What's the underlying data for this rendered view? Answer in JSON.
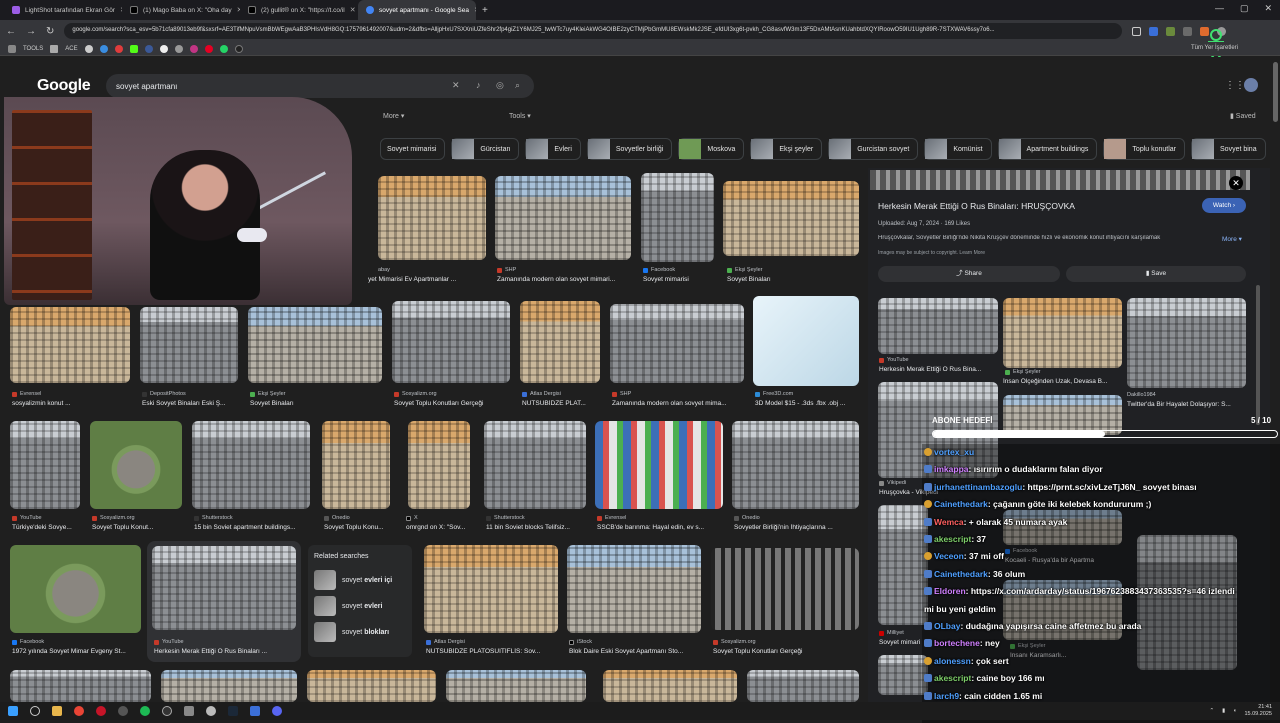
{
  "tabs": [
    {
      "label": "LightShot tarafından Ekran Gör"
    },
    {
      "label": "(1) Mago Baba on X: \"Oha day"
    },
    {
      "label": "(2) gullit® on X: \"https://t.co/il"
    },
    {
      "label": "sovyet apartmanı - Google Sea"
    }
  ],
  "url": "google.com/search?sca_esv=5b71cfa89013eb9f&sxsrf=AE3TifMNpuVsmBbWEgwAaB3PHIsVdH8GQ:1757961492007&udm=2&dfbs=AlljpHxU7SXXniUZfeShr2fp4giZ1Y6MJ25_twWTc7uy4KleiAkWG4OIBE2zyCTMjPbGmMU8EWskMk2JSE_efdUI3xg6t-pvkh_CG8asvfW3m13F5DxAMtAsnKUahbtdXQYIRoowO59IU1Ugh89R-7STXWAV6ssy7o6...",
  "bookmarks": [
    "TOOLS",
    "ACE"
  ],
  "bookmarks_all": "Tüm Yer İşaretleri",
  "google": {
    "logo": "Google",
    "query": "sovyet apartmanı",
    "more": "More",
    "tools": "Tools",
    "saved": "Saved"
  },
  "chips": [
    "Sovyet mimarisi",
    "Gürcistan",
    "Evleri",
    "Sovyetler birliği",
    "Moskova",
    "Ekşi şeyler",
    "Gurcistan sovyet",
    "Komünist",
    "Apartment buildings",
    "Toplu konutlar",
    "Sovyet bina"
  ],
  "results": [
    {
      "src": "abay",
      "cap": "yet Mimarisi Ev Apartmanlar ..."
    },
    {
      "src": "SHP",
      "cap": "Zamanında modern olan sovyet mimari..."
    },
    {
      "src": "Facebook",
      "cap": "Sovyet mimarisi"
    },
    {
      "src": "Ekşi Şeyler",
      "cap": "Sovyet Binaları"
    },
    {
      "src": "Evrensel",
      "cap": "sosyalizmin konut ..."
    },
    {
      "src": "DepositPhotos",
      "cap": "Eski Sovyet Binaları Eski Ş..."
    },
    {
      "src": "Ekşi Şeyler",
      "cap": "Sovyet Binaları"
    },
    {
      "src": "Sosyalizm.org",
      "cap": "Sovyet Toplu Konutları Gerçeği"
    },
    {
      "src": "Atlas Dergisi",
      "cap": "NUTSUBİDZE PLAT..."
    },
    {
      "src": "SHP",
      "cap": "Zamanında modern olan sovyet mima..."
    },
    {
      "src": "Free3D.com",
      "cap": "3D Model $15 - .3ds .fbx .obj ..."
    },
    {
      "src": "YouTube",
      "cap": "Türkiye'deki Sovye..."
    },
    {
      "src": "Sosyalizm.org",
      "cap": "Sovyet Toplu Konut..."
    },
    {
      "src": "Shutterstock",
      "cap": "15 bin Soviet apartment buildings..."
    },
    {
      "src": "Onedio",
      "cap": "Sovyet Toplu Konu..."
    },
    {
      "src": "X",
      "cap": "omrgnd on X: \"Sov..."
    },
    {
      "src": "Shutterstock",
      "cap": "11 bin Soviet blocks Telifsiz..."
    },
    {
      "src": "Evrensel",
      "cap": "SSCB'de barınma: Hayal edin, ev s..."
    },
    {
      "src": "Onedio",
      "cap": "Sovyetler Birliği'nin İhtiyaçlarına ..."
    },
    {
      "src": "Facebook",
      "cap": "1972 yılında Sovyet Mimar Evgeny St..."
    },
    {
      "src": "YouTube",
      "cap": "Herkesin Merak Ettiği O Rus Binaları ..."
    },
    {
      "src": "Atlas Dergisi",
      "cap": "NUTSUBİDZE PLATOSUITİFLİS: Sov..."
    },
    {
      "src": "iStock",
      "cap": "Blok Daire Eski Sovyet Apartmanı Sto..."
    },
    {
      "src": "Sosyalizm.org",
      "cap": "Sovyet Toplu Konutları Gerçeği"
    }
  ],
  "related": {
    "title": "Related searches",
    "items": [
      {
        "pre": "sovyet ",
        "bold": "evleri içi"
      },
      {
        "pre": "sovyet ",
        "bold": "evleri"
      },
      {
        "pre": "sovyet ",
        "bold": "blokları"
      }
    ]
  },
  "panel": {
    "title": "Herkesin Merak Ettiği O Rus Binaları: HRUŞÇOVKA",
    "watch": "Watch",
    "meta": "Uploaded: Aug 7, 2024 · 169 Likes",
    "desc": "Hruşçovkalar, Sovyetler Birliği'nde Nikita Kruşçev döneminde hızlı ve ekonomik konut ihtiyacını karşılamak",
    "more": "More",
    "copyright": "Images may be subject to copyright. Learn More",
    "share": "Share",
    "save": "Save",
    "related": [
      {
        "src": "YouTube",
        "cap": "Herkesin Merak Ettiği O Rus Bina..."
      },
      {
        "src": "Ekşi Şeyler",
        "cap": "İnsan Ölçeğinden Uzak, Devasa B..."
      },
      {
        "src": "Dakillo1984",
        "cap": "Twitter'da Bir Hayalet Dolaşıyor: S..."
      },
      {
        "src": "Vikipedi",
        "cap": "Hruşçovka - Vikipedi"
      },
      {
        "src": "Facebook",
        "cap": "Kocaeli - Rusya'da bir Apartma"
      },
      {
        "src": "Milliyet",
        "cap": "Sovyet mimari"
      },
      {
        "src": "Ekşi Şeyler",
        "cap": "Insanı Karamsarlı..."
      }
    ]
  },
  "overlay": {
    "goal_label": "ABONE HEDEFİ",
    "goal_count": "5 / 10",
    "goal_fraction": 0.5
  },
  "chat": [
    {
      "user": "vortex_xu",
      "msg": "",
      "cls": "b"
    },
    {
      "user": "imkappa",
      "msg": ": ısırırım o dudaklarını falan diyor",
      "cls": "p"
    },
    {
      "user": "jurhanettinambazoglu",
      "msg": ": https://prnt.sc/xivLzeTjJ6N_ sovyet binası",
      "cls": "b"
    },
    {
      "user": "Cainethedark",
      "msg": ": çağanın göte iki kelebek kondururum ;)",
      "cls": "b"
    },
    {
      "user": "Wemca",
      "msg": ": + olarak 45 numara ayak",
      "cls": "r"
    },
    {
      "user": "akescript",
      "msg": ": 37",
      "cls": "g"
    },
    {
      "user": "Veceon",
      "msg": ": 37 mi off",
      "cls": "b"
    },
    {
      "user": "Cainethedark",
      "msg": ": 36 olum",
      "cls": "b"
    },
    {
      "user": "Eldoren",
      "msg": ": https://x.com/ardarday/status/1967623883437363535?s=46 izlendi",
      "cls": "p"
    },
    {
      "user": "",
      "msg": "mi bu yeni geldim",
      "cls": ""
    },
    {
      "user": "OLbay",
      "msg": ": dudağına yapışırsa caine affetmez bu arada",
      "cls": "b"
    },
    {
      "user": "bortechene",
      "msg": ": ney",
      "cls": "p"
    },
    {
      "user": "alonessn",
      "msg": ": çok sert",
      "cls": "b"
    },
    {
      "user": "akescript",
      "msg": ": caine boy 166 mı",
      "cls": "g"
    },
    {
      "user": "larch9",
      "msg": ": cain cidden 1.65 mi",
      "cls": "b"
    },
    {
      "user": "akescript",
      "msg": ": 36.5",
      "cls": "g"
    }
  ],
  "clock": {
    "time": "21:41",
    "date": "15.09.2025"
  },
  "colors": {
    "bg": "#1f1f1f",
    "accent": "#8ab4f8",
    "tab_active": "#35363a"
  }
}
